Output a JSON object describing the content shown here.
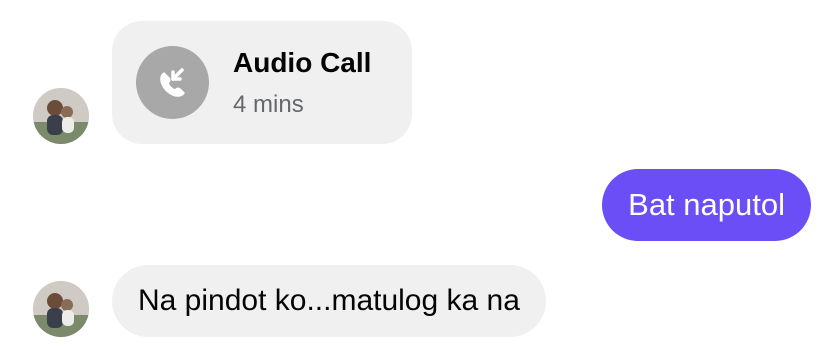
{
  "messages": [
    {
      "type": "call",
      "direction": "incoming",
      "title": "Audio Call",
      "duration": "4 mins",
      "icon": "missed-call-arrow-icon"
    },
    {
      "type": "text",
      "direction": "outgoing",
      "text": "Bat naputol"
    },
    {
      "type": "text",
      "direction": "incoming",
      "text": "Na pindot ko...matulog ka na"
    }
  ],
  "colors": {
    "outgoing_bubble": "#6c4ef6",
    "incoming_bubble": "#f0f0f0",
    "call_icon_bg": "#a8a8a8",
    "secondary_text": "#65676b"
  }
}
